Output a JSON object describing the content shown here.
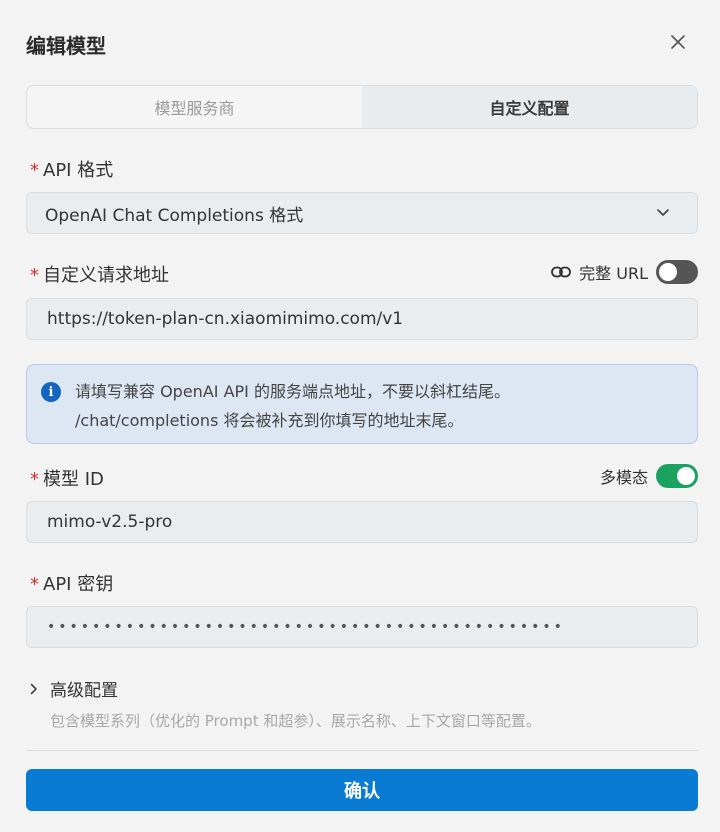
{
  "dialog": {
    "title": "编辑模型",
    "close_icon": "close-icon"
  },
  "tabs": [
    {
      "label": "模型服务商",
      "active": false
    },
    {
      "label": "自定义配置",
      "active": true
    }
  ],
  "api_format": {
    "required_mark": "*",
    "label": "API 格式",
    "value": "OpenAI Chat Completions 格式"
  },
  "endpoint": {
    "required_mark": "*",
    "label": "自定义请求地址",
    "full_url_label": "完整 URL",
    "full_url_on": false,
    "value": "https://token-plan-cn.xiaomimimo.com/v1"
  },
  "info": {
    "line1": "请填写兼容 OpenAI API 的服务端点地址，不要以斜杠结尾。",
    "line2": "/chat/completions 将会被补充到你填写的地址末尾。",
    "icon_glyph": "i"
  },
  "model_id": {
    "required_mark": "*",
    "label": "模型 ID",
    "multimodal_label": "多模态",
    "multimodal_on": true,
    "value": "mimo-v2.5-pro"
  },
  "api_key": {
    "required_mark": "*",
    "label": "API 密钥",
    "masked_value": "••••••••••••••••••••••••••••••••••••••••••••••"
  },
  "advanced": {
    "label": "高级配置",
    "description": "包含模型系列（优化的 Prompt 和超参）、展示名称、上下文窗口等配置。"
  },
  "footer": {
    "confirm_label": "确认"
  },
  "colors": {
    "accent": "#0a7bd3",
    "required": "#d32f2f",
    "toggle_on": "#1aa260",
    "toggle_off": "#555555"
  }
}
